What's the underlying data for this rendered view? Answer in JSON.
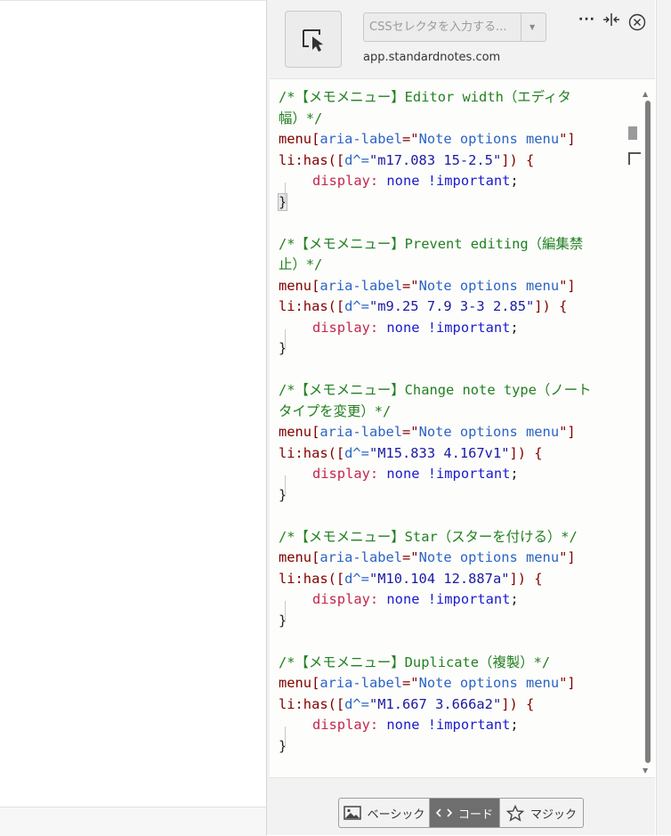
{
  "toolbar": {
    "selector_placeholder": "CSSセレクタを入力する...",
    "domain": "app.standardnotes.com",
    "more_label": "···"
  },
  "code": {
    "blocks": [
      {
        "comment": [
          "/*【メモメニュー】Editor width（エディタ",
          "幅）*/"
        ],
        "selector_prefix": "menu[",
        "attr": "aria-label",
        "eq": "=\"",
        "attr_value": "Note options menu",
        "close": "\"]",
        "has_prefix": "li:has([",
        "d_attr": "d^=",
        "d_value": "\"m17.083 15-2.5\"",
        "has_close": "]) {",
        "property": "display:",
        "value": " none ",
        "important": "!important",
        "semi": ";",
        "end": "}"
      },
      {
        "comment": [
          "/*【メモメニュー】Prevent editing（編集禁",
          "止）*/"
        ],
        "selector_prefix": "menu[",
        "attr": "aria-label",
        "eq": "=\"",
        "attr_value": "Note options menu",
        "close": "\"]",
        "has_prefix": "li:has([",
        "d_attr": "d^=",
        "d_value": "\"m9.25 7.9 3-3 2.85\"",
        "has_close": "]) {",
        "property": "display:",
        "value": " none ",
        "important": "!important",
        "semi": ";",
        "end": "}"
      },
      {
        "comment": [
          "/*【メモメニュー】Change note type（ノート",
          "タイプを変更）*/"
        ],
        "selector_prefix": "menu[",
        "attr": "aria-label",
        "eq": "=\"",
        "attr_value": "Note options menu",
        "close": "\"]",
        "has_prefix": "li:has([",
        "d_attr": "d^=",
        "d_value": "\"M15.833 4.167v1\"",
        "has_close": "]) {",
        "property": "display:",
        "value": " none ",
        "important": "!important",
        "semi": ";",
        "end": "}"
      },
      {
        "comment": [
          "/*【メモメニュー】Star（スターを付ける）*/"
        ],
        "selector_prefix": "menu[",
        "attr": "aria-label",
        "eq": "=\"",
        "attr_value": "Note options menu",
        "close": "\"]",
        "has_prefix": "li:has([",
        "d_attr": "d^=",
        "d_value": "\"M10.104 12.887a\"",
        "has_close": "]) {",
        "property": "display:",
        "value": " none ",
        "important": "!important",
        "semi": ";",
        "end": "}"
      },
      {
        "comment": [
          "/*【メモメニュー】Duplicate（複製）*/"
        ],
        "selector_prefix": "menu[",
        "attr": "aria-label",
        "eq": "=\"",
        "attr_value": "Note options menu",
        "close": "\"]",
        "has_prefix": "li:has([",
        "d_attr": "d^=",
        "d_value": "\"M1.667 3.666a2\"",
        "has_close": "]) {",
        "property": "display:",
        "value": " none ",
        "important": "!important",
        "semi": ";",
        "end": "}"
      }
    ]
  },
  "tabs": [
    {
      "label": "ベーシック",
      "icon": "image-icon",
      "active": false
    },
    {
      "label": "コード",
      "icon": "code-icon",
      "active": true
    },
    {
      "label": "マジック",
      "icon": "star-icon",
      "active": false
    }
  ],
  "colors": {
    "comment": "#218021",
    "selector": "#800000",
    "attribute": "#2b63c7",
    "string": "#1a1aa6",
    "property": "#c4254f",
    "keyword": "#1a1ad0",
    "active_tab": "#6e6e6e"
  }
}
